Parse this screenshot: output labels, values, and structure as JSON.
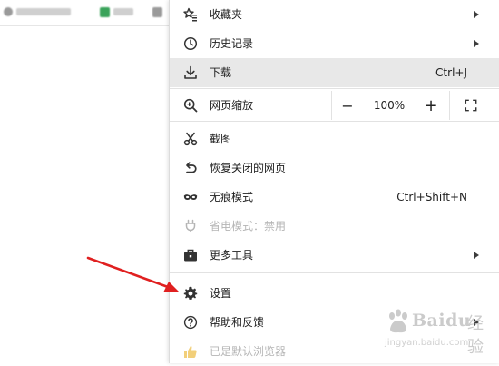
{
  "background": {
    "tab1_text": "■ ■ ■ ■ ■ ■",
    "tab2_text": "■ ■",
    "accent": "#3aa35a"
  },
  "menu": {
    "items": [
      {
        "label": "收藏夹",
        "icon": "bookmark-star-icon",
        "submenu": true
      },
      {
        "label": "历史记录",
        "icon": "clock-icon",
        "submenu": true
      },
      {
        "label": "下载",
        "icon": "download-icon",
        "shortcut": "Ctrl+J",
        "highlighted": true
      },
      {
        "label": "截图",
        "icon": "scissors-icon"
      },
      {
        "label": "恢复关闭的网页",
        "icon": "undo-icon"
      },
      {
        "label": "无痕模式",
        "icon": "incognito-mask-icon",
        "shortcut": "Ctrl+Shift+N"
      },
      {
        "label": "省电模式：禁用",
        "icon": "power-plug-icon",
        "disabled": true
      },
      {
        "label": "更多工具",
        "icon": "toolbox-icon",
        "submenu": true
      },
      {
        "label": "设置",
        "icon": "gear-icon"
      },
      {
        "label": "帮助和反馈",
        "icon": "help-circle-icon",
        "submenu": true
      },
      {
        "label": "已是默认浏览器",
        "icon": "thumbs-up-icon",
        "disabled": true
      }
    ],
    "zoom": {
      "label": "网页缩放",
      "minus": "−",
      "value": "100%",
      "plus": "+",
      "fullscreen_icon": "fullscreen-icon"
    }
  },
  "annotation": {
    "arrow_color": "#e02020"
  },
  "watermark": {
    "brand": "Baidu",
    "brand_zh": "经验",
    "url": "jingyan.baidu.com"
  }
}
